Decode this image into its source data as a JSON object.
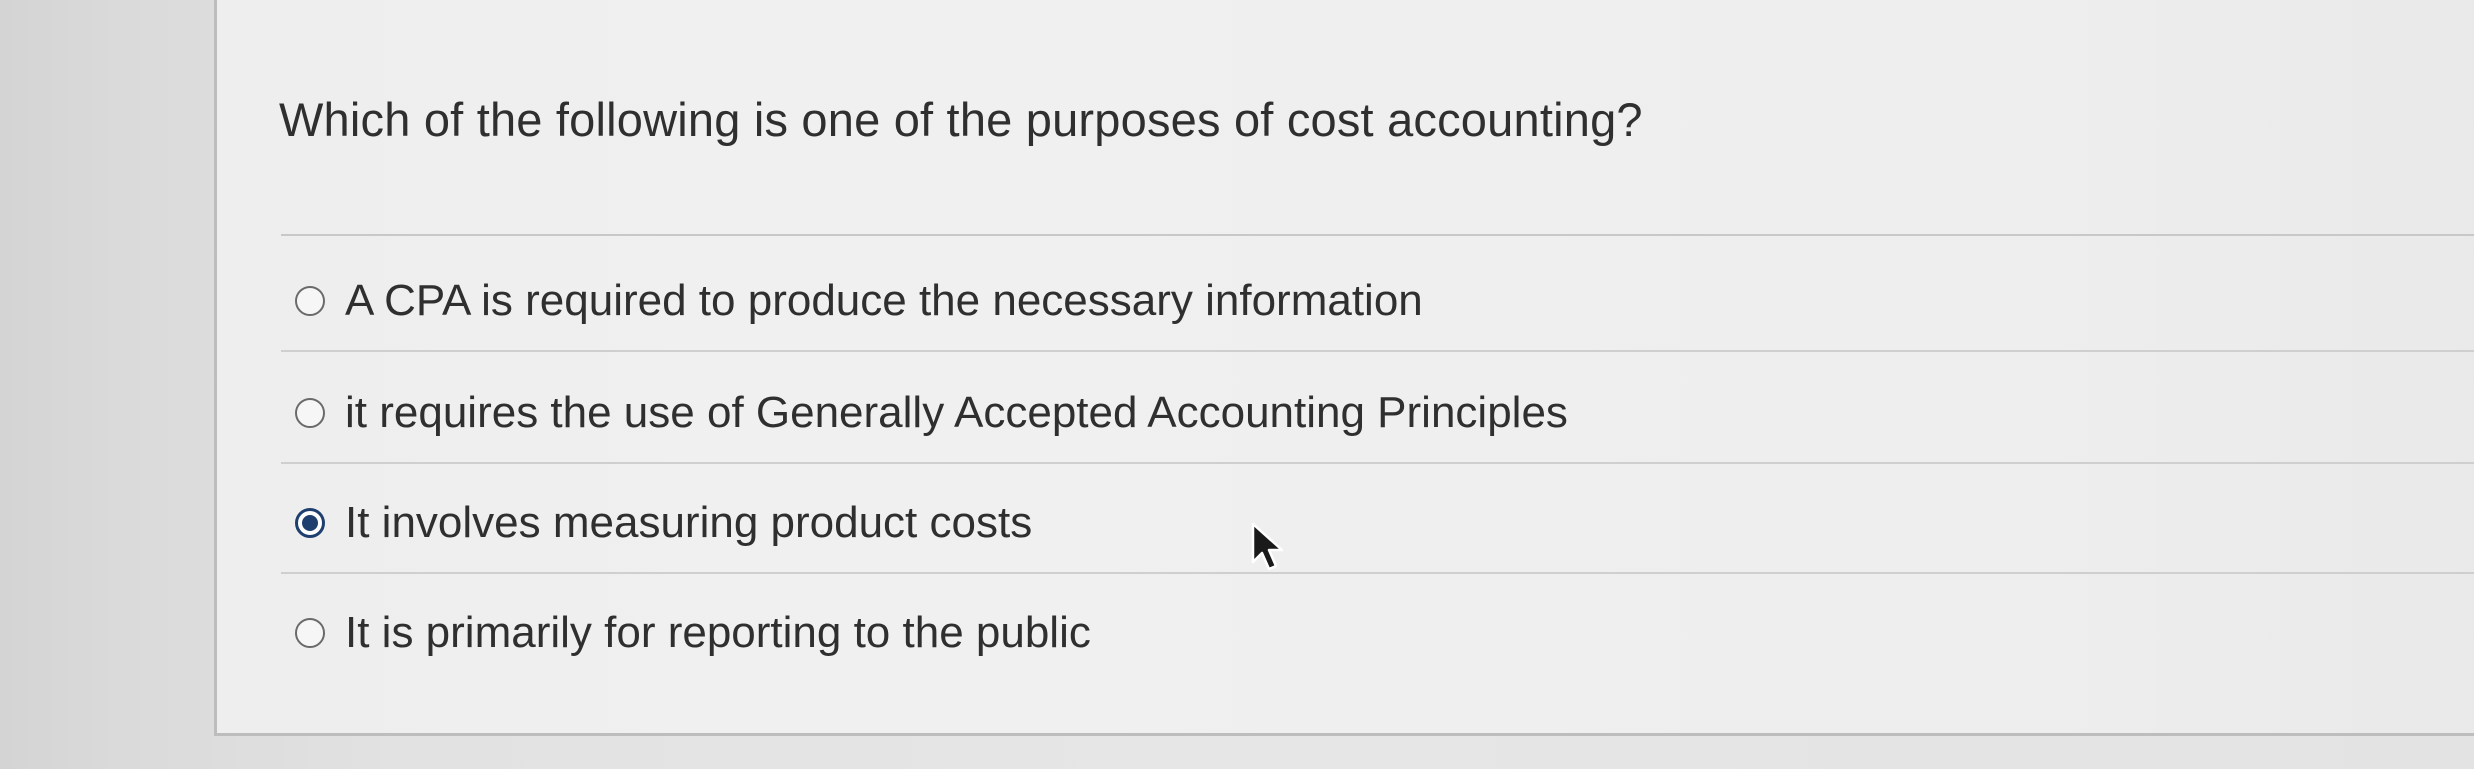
{
  "question": {
    "text": "Which of the following is one of the purposes of cost accounting?"
  },
  "options": [
    {
      "label": "A CPA is required to produce the necessary information",
      "selected": false
    },
    {
      "label": "it requires the use of Generally Accepted Accounting Principles",
      "selected": false
    },
    {
      "label": "It involves measuring product costs",
      "selected": true
    },
    {
      "label": "It is primarily for reporting to the public",
      "selected": false
    }
  ],
  "colors": {
    "selected_radio": "#1f3f6e",
    "text": "#2f2f2f"
  },
  "cursor": {
    "icon": "mouse-pointer-icon"
  }
}
